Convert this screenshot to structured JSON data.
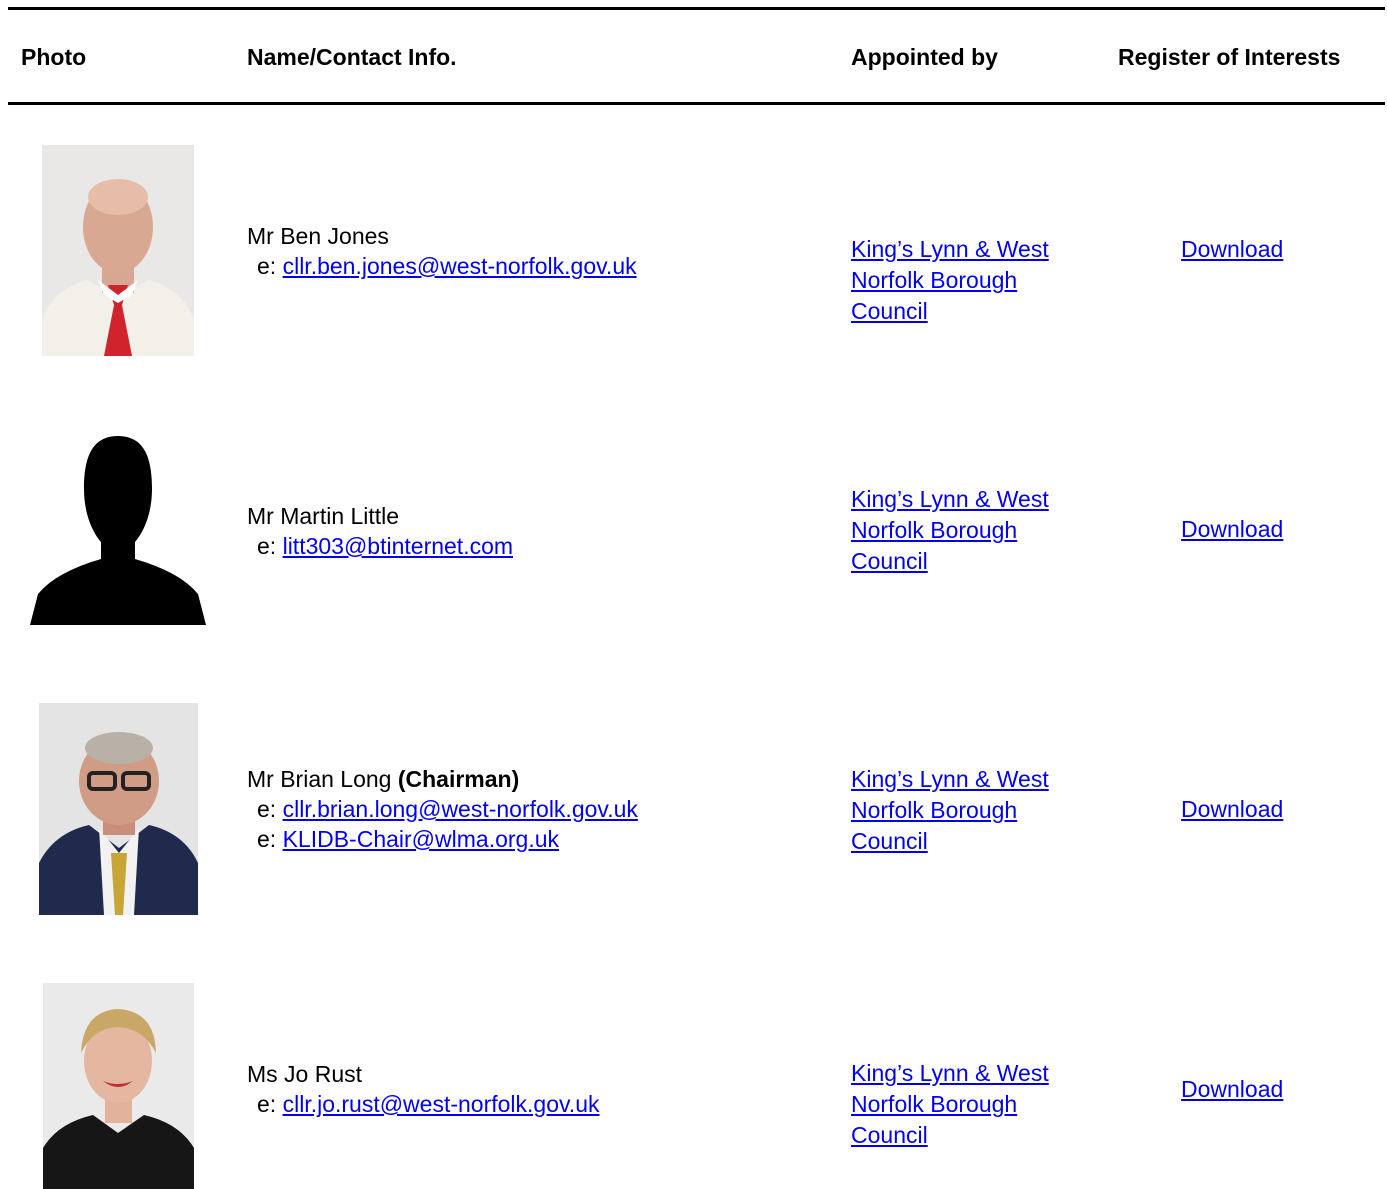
{
  "header": {
    "photo": "Photo",
    "name": "Name/Contact Info.",
    "appointed": "Appointed by",
    "register": "Register of Interests"
  },
  "members": [
    {
      "name": "Mr Ben Jones",
      "role": "",
      "email_prefix": "e:",
      "emails": [
        "cllr.ben.jones@west-norfolk.gov.uk"
      ],
      "appointed_lines": [
        "King’s Lynn & West",
        "Norfolk Borough",
        "Council"
      ],
      "register": "Download",
      "photo_icon": "portrait-photo"
    },
    {
      "name": "Mr Martin Little",
      "role": "",
      "email_prefix": "e:",
      "emails": [
        "litt303@btinternet.com"
      ],
      "appointed_lines": [
        "King’s Lynn & West",
        "Norfolk Borough",
        "Council"
      ],
      "register": "Download",
      "photo_icon": "silhouette-placeholder"
    },
    {
      "name": "Mr Brian Long",
      "role": "(Chairman)",
      "email_prefix": "e:",
      "emails": [
        "cllr.brian.long@west-norfolk.gov.uk",
        "KLIDB-Chair@wlma.org.uk"
      ],
      "appointed_lines": [
        "King’s Lynn & West",
        "Norfolk Borough",
        "Council"
      ],
      "register": "Download",
      "photo_icon": "portrait-photo"
    },
    {
      "name": "Ms Jo Rust",
      "role": "",
      "email_prefix": "e:",
      "emails": [
        "cllr.jo.rust@west-norfolk.gov.uk"
      ],
      "appointed_lines": [
        "King’s Lynn & West",
        "Norfolk Borough",
        "Council"
      ],
      "register": "Download",
      "photo_icon": "portrait-photo"
    }
  ]
}
